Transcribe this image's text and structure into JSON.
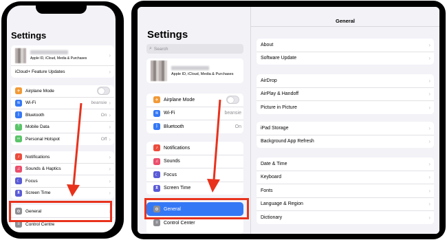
{
  "phone": {
    "title": "Settings",
    "account_subtitle": "Apple ID, iCloud, Media & Purchases",
    "icloud_updates": "iCloud+ Feature Updates",
    "group1": [
      {
        "label": "Airplane Mode",
        "icon": "airplane-icon",
        "color": "#f19a37",
        "toggle": true
      },
      {
        "label": "Wi-Fi",
        "icon": "wifi-icon",
        "color": "#3478f6",
        "value": "beansie"
      },
      {
        "label": "Bluetooth",
        "icon": "bluetooth-icon",
        "color": "#3478f6",
        "value": "On"
      },
      {
        "label": "Mobile Data",
        "icon": "antenna-icon",
        "color": "#5ac469"
      },
      {
        "label": "Personal Hotspot",
        "icon": "hotspot-icon",
        "color": "#5ac469",
        "value": "Off"
      }
    ],
    "group2": [
      {
        "label": "Notifications",
        "icon": "bell-icon",
        "color": "#eb4d3d"
      },
      {
        "label": "Sounds & Haptics",
        "icon": "speaker-icon",
        "color": "#eb4e6b"
      },
      {
        "label": "Focus",
        "icon": "moon-icon",
        "color": "#5a5bd6"
      },
      {
        "label": "Screen Time",
        "icon": "hourglass-icon",
        "color": "#5a5bd6"
      }
    ],
    "general": "General",
    "control_centre": "Control Centre"
  },
  "tablet": {
    "sidebar": {
      "title": "Settings",
      "search_placeholder": "Search",
      "account_subtitle": "Apple ID, iCloud, Media & Purchases",
      "group1": [
        {
          "label": "Airplane Mode",
          "icon": "airplane-icon",
          "color": "#f19a37",
          "toggle": true
        },
        {
          "label": "Wi-Fi",
          "icon": "wifi-icon",
          "color": "#3478f6",
          "value": "beansie"
        },
        {
          "label": "Bluetooth",
          "icon": "bluetooth-icon",
          "color": "#3478f6",
          "value": "On"
        }
      ],
      "group2": [
        {
          "label": "Notifications",
          "icon": "bell-icon",
          "color": "#eb4d3d"
        },
        {
          "label": "Sounds",
          "icon": "speaker-icon",
          "color": "#eb4e6b"
        },
        {
          "label": "Focus",
          "icon": "moon-icon",
          "color": "#5a5bd6"
        },
        {
          "label": "Screen Time",
          "icon": "hourglass-icon",
          "color": "#5a5bd6"
        }
      ],
      "general": "General",
      "control_center": "Control Center"
    },
    "detail": {
      "title": "General",
      "groups": [
        [
          "About",
          "Software Update"
        ],
        [
          "AirDrop",
          "AirPlay & Handoff",
          "Picture in Picture"
        ],
        [
          "iPad Storage",
          "Background App Refresh"
        ],
        [
          "Date & Time",
          "Keyboard",
          "Fonts",
          "Language & Region",
          "Dictionary"
        ]
      ]
    }
  },
  "colors": {
    "highlight": "#e8321c",
    "selected": "#3478f6"
  }
}
